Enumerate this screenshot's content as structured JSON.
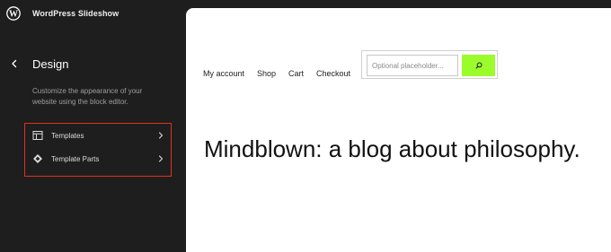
{
  "colors": {
    "sidebar_bg": "#1e1e1e",
    "canvas_bg": "#ffffff",
    "highlight_border": "#e0311b",
    "search_button": "#9bfc2c"
  },
  "sidebar": {
    "site_title": "WordPress Slideshow",
    "logo_icon": "wordpress-logo-icon",
    "back_icon": "chevron-left-icon",
    "panel_title": "Design",
    "description": "Customize the appearance of your website using the block editor.",
    "items": [
      {
        "label": "Templates",
        "icon": "layout-icon"
      },
      {
        "label": "Template Parts",
        "icon": "symbol-diamond-icon"
      }
    ]
  },
  "preview": {
    "nav": [
      "My account",
      "Shop",
      "Cart",
      "Checkout"
    ],
    "search": {
      "placeholder": "Optional placeholder...",
      "value": "",
      "button_icon": "search-icon"
    },
    "headline": "Mindblown: a blog about philosophy."
  }
}
